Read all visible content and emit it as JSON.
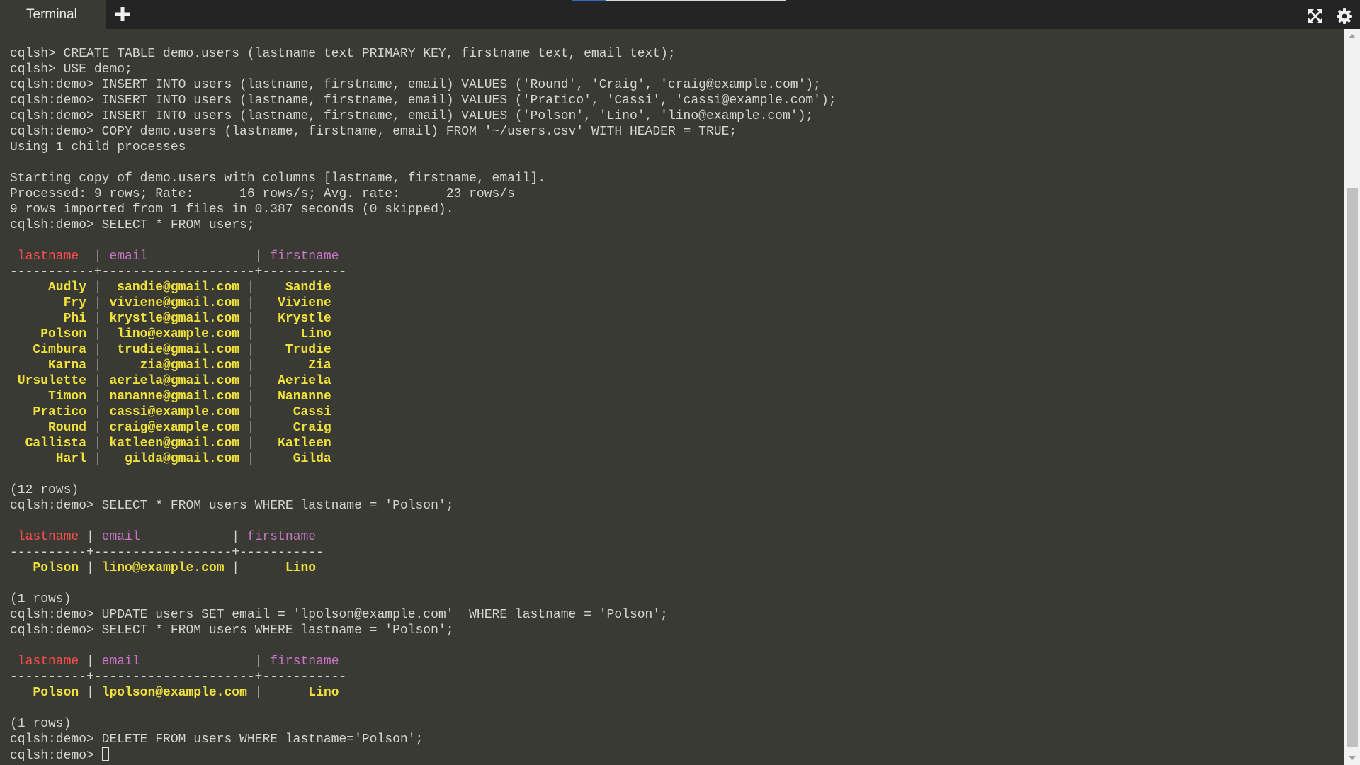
{
  "app": {
    "tab_label": "Terminal",
    "add_tab_icon": "plus-icon",
    "fullscreen_icon": "fullscreen-icon",
    "settings_icon": "gear-icon",
    "colors": {
      "background": "#3a3a34",
      "topbar": "#242424",
      "text": "#d4d4d0",
      "header_lastname": "#ff4c4c",
      "header_other": "#c874c8",
      "values": "#f0e23a",
      "progress": "#2b6cc4"
    },
    "progress_fraction": 0.16
  },
  "terminal": {
    "lines": [
      "cqlsh> CREATE TABLE demo.users (lastname text PRIMARY KEY, firstname text, email text);",
      "cqlsh> USE demo;",
      "cqlsh:demo> INSERT INTO users (lastname, firstname, email) VALUES ('Round', 'Craig', 'craig@example.com');",
      "cqlsh:demo> INSERT INTO users (lastname, firstname, email) VALUES ('Pratico', 'Cassi', 'cassi@example.com');",
      "cqlsh:demo> INSERT INTO users (lastname, firstname, email) VALUES ('Polson', 'Lino', 'lino@example.com');",
      "cqlsh:demo> COPY demo.users (lastname, firstname, email) FROM '~/users.csv' WITH HEADER = TRUE;",
      "Using 1 child processes",
      "",
      "Starting copy of demo.users with columns [lastname, firstname, email].",
      "Processed: 9 rows; Rate:      16 rows/s; Avg. rate:      23 rows/s",
      "9 rows imported from 1 files in 0.387 seconds (0 skipped).",
      "cqlsh:demo> SELECT * FROM users;",
      "",
      " lastname  | email              | firstname",
      "-----------+--------------------+-----------",
      "     Audly |  sandie@gmail.com |    Sandie",
      "       Fry | viviene@gmail.com |   Viviene",
      "       Phi | krystle@gmail.com |   Krystle",
      "    Polson |  lino@example.com |      Lino",
      "   Cimbura |  trudie@gmail.com |    Trudie",
      "     Karna |     zia@gmail.com |       Zia",
      " Ursulette | aeriela@gmail.com |   Aeriela",
      "     Timon | nananne@gmail.com |   Nananne",
      "   Pratico | cassi@example.com |     Cassi",
      "     Round | craig@example.com |     Craig",
      "  Callista | katleen@gmail.com |   Katleen",
      "      Harl |   gilda@gmail.com |     Gilda",
      "",
      "(12 rows)",
      "cqlsh:demo> SELECT * FROM users WHERE lastname = 'Polson';",
      "",
      " lastname | email            | firstname",
      "----------+------------------+-----------",
      "   Polson | lino@example.com |      Lino",
      "",
      "(1 rows)",
      "cqlsh:demo> UPDATE users SET email = 'lpolson@example.com'  WHERE lastname = 'Polson';",
      "cqlsh:demo> SELECT * FROM users WHERE lastname = 'Polson';",
      "",
      " lastname | email               | firstname",
      "----------+---------------------+-----------",
      "   Polson | lpolson@example.com |      Lino",
      "",
      "(1 rows)",
      "cqlsh:demo> DELETE FROM users WHERE lastname='Polson';",
      "cqlsh:demo> "
    ],
    "table_header_lines": [
      13,
      31,
      39
    ],
    "table_row_lines": [
      15,
      16,
      17,
      18,
      19,
      20,
      21,
      22,
      23,
      24,
      25,
      26,
      33,
      41
    ],
    "prompt_line": 45
  }
}
